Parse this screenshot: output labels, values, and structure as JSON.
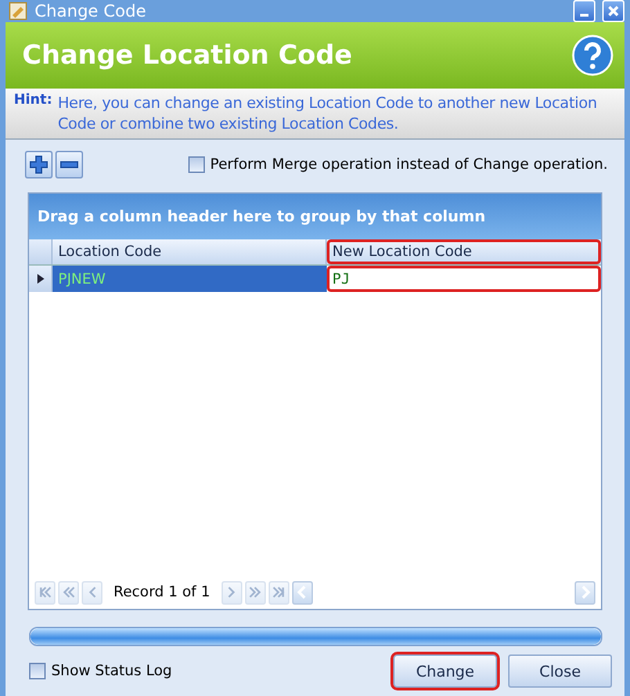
{
  "window": {
    "title": "Change Code"
  },
  "header": {
    "title": "Change Location Code"
  },
  "hint": {
    "label": "Hint:",
    "text": "Here, you can change an existing Location Code to another new Location Code or combine two existing Location Codes."
  },
  "toolbar": {
    "buttons": [
      {
        "kind": "add"
      },
      {
        "kind": "remove"
      }
    ],
    "merge_option": {
      "label": "Perform Merge operation instead of Change operation.",
      "checked": false
    }
  },
  "grid": {
    "group_panel": "Drag a column header here to group by that column",
    "columns": [
      {
        "label": "Location Code",
        "highlighted": false
      },
      {
        "label": "New Location Code",
        "highlighted": true
      }
    ],
    "rows": [
      {
        "selected": true,
        "cells": [
          {
            "text": "PJNEW",
            "editing": false
          },
          {
            "text": "PJ",
            "editing": true
          }
        ]
      }
    ],
    "navigator": {
      "record_text": "Record 1 of 1",
      "buttons_before": [
        {
          "kind": "first",
          "disabled": true
        },
        {
          "kind": "prev-page",
          "disabled": true
        },
        {
          "kind": "prev",
          "disabled": true
        }
      ],
      "buttons_after": [
        {
          "kind": "next",
          "disabled": true
        },
        {
          "kind": "next-page",
          "disabled": true
        },
        {
          "kind": "last",
          "disabled": true
        }
      ]
    }
  },
  "progress": {
    "level": 1
  },
  "show_status_log": {
    "label": "Show Status Log",
    "checked": false
  },
  "buttons": [
    {
      "label": "Change",
      "highlighted": true
    },
    {
      "label": "Close",
      "highlighted": false
    }
  ]
}
